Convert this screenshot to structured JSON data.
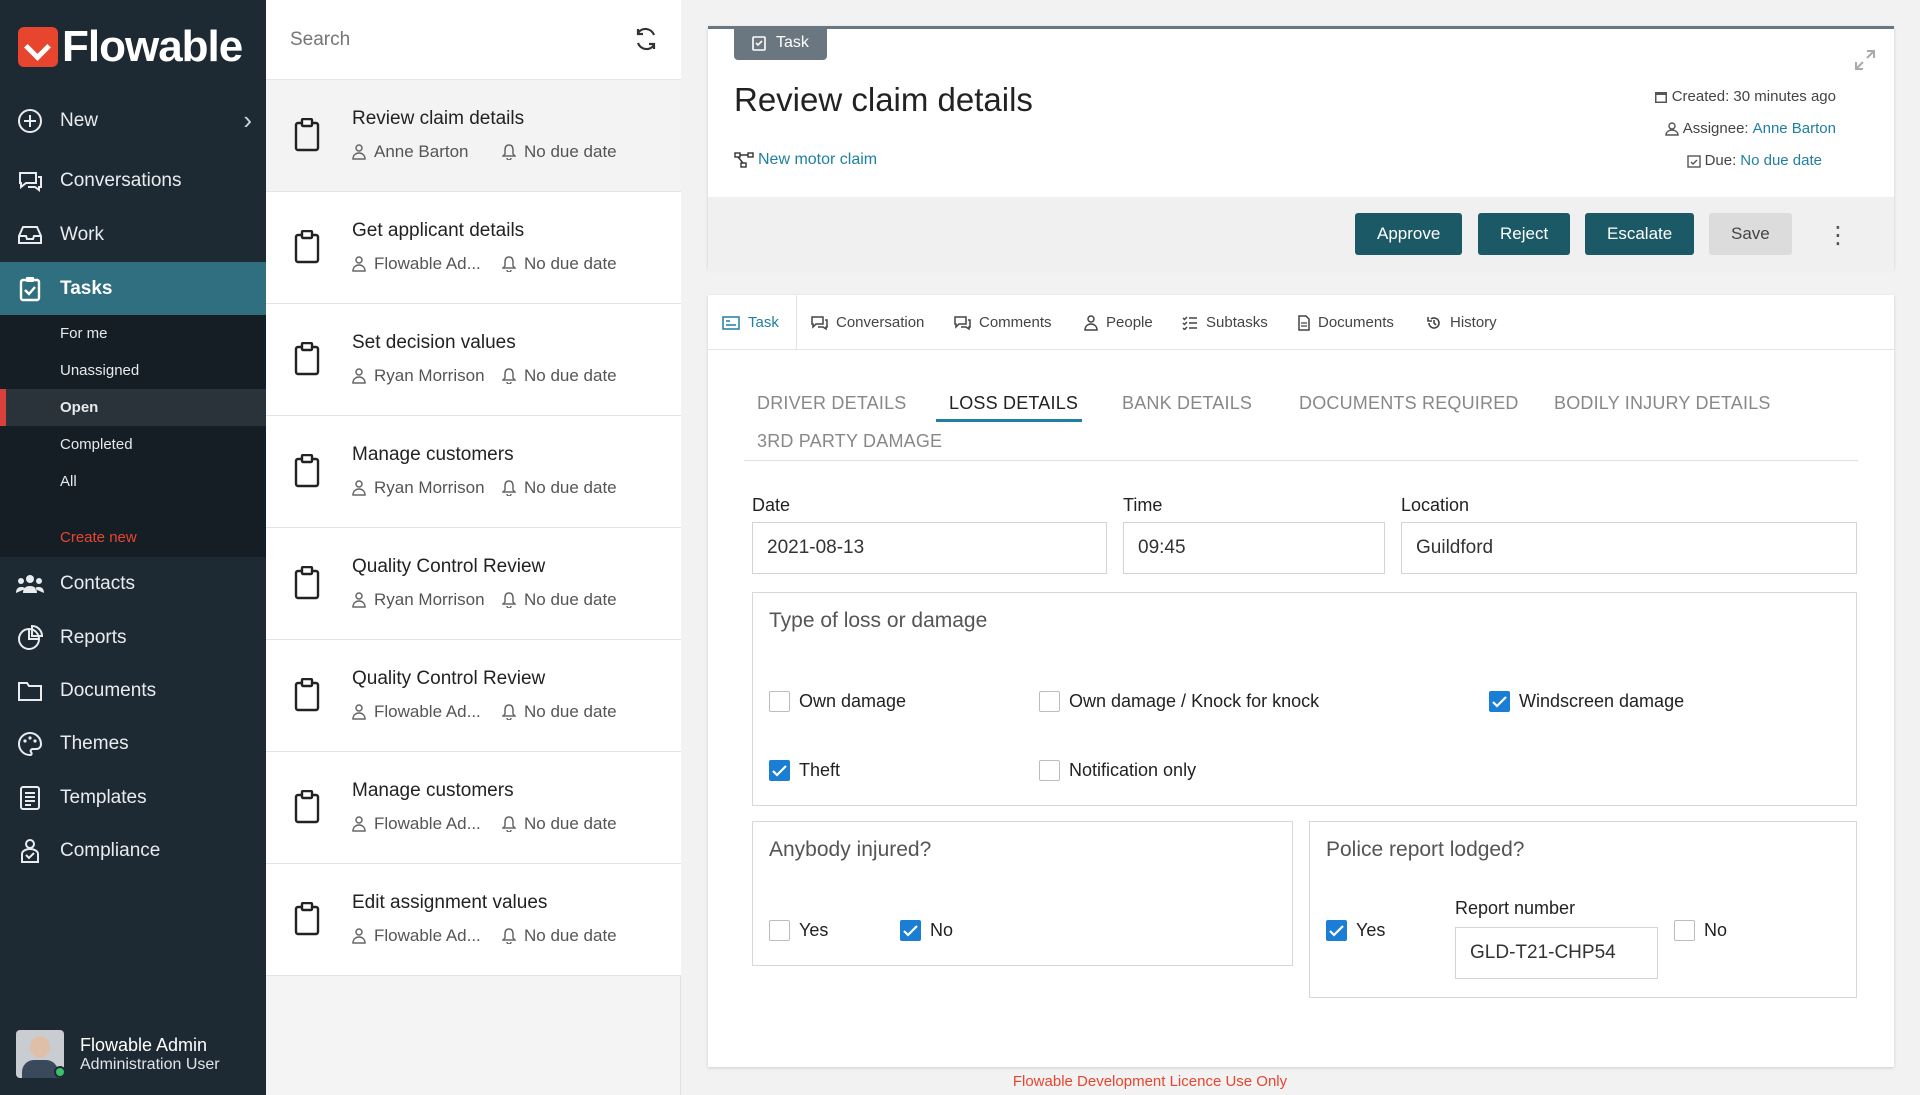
{
  "brand": {
    "name": "Flowable",
    "accent": "#e8452f"
  },
  "sidebar": {
    "items": [
      {
        "label": "New",
        "icon": "plus-circle-icon"
      },
      {
        "label": "Conversations",
        "icon": "chat-icon"
      },
      {
        "label": "Work",
        "icon": "inbox-icon"
      },
      {
        "label": "Tasks",
        "icon": "clipboard-check-icon"
      },
      {
        "label": "Contacts",
        "icon": "users-icon"
      },
      {
        "label": "Reports",
        "icon": "pie-chart-icon"
      },
      {
        "label": "Documents",
        "icon": "folder-icon"
      },
      {
        "label": "Themes",
        "icon": "palette-icon"
      },
      {
        "label": "Templates",
        "icon": "file-text-icon"
      },
      {
        "label": "Compliance",
        "icon": "compliance-icon"
      }
    ],
    "sub_items": [
      "For me",
      "Unassigned",
      "Open",
      "Completed",
      "All",
      "Create new"
    ],
    "active_item": "Tasks",
    "active_sub": "Open",
    "user": {
      "name": "Flowable Admin",
      "role": "Administration User"
    }
  },
  "tasklist": {
    "search_placeholder": "Search",
    "tasks": [
      {
        "title": "Review claim details",
        "assignee": "Anne Barton",
        "due": "No due date"
      },
      {
        "title": "Get applicant details",
        "assignee": "Flowable Ad...",
        "due": "No due date"
      },
      {
        "title": "Set decision values",
        "assignee": "Ryan Morrison",
        "due": "No due date"
      },
      {
        "title": "Manage customers",
        "assignee": "Ryan Morrison",
        "due": "No due date"
      },
      {
        "title": "Quality Control Review",
        "assignee": "Ryan Morrison",
        "due": "No due date"
      },
      {
        "title": "Quality Control Review",
        "assignee": "Flowable Ad...",
        "due": "No due date"
      },
      {
        "title": "Manage customers",
        "assignee": "Flowable Ad...",
        "due": "No due date"
      },
      {
        "title": "Edit assignment values",
        "assignee": "Flowable Ad...",
        "due": "No due date"
      }
    ]
  },
  "header": {
    "chip": "Task",
    "title": "Review claim details",
    "case_link": "New motor claim",
    "created": "Created: 30 minutes ago",
    "assignee_label": "Assignee:",
    "assignee": "Anne Barton",
    "due_label": "Due:",
    "due": "No due date",
    "buttons": {
      "approve": "Approve",
      "reject": "Reject",
      "escalate": "Escalate",
      "save": "Save"
    }
  },
  "tabs": [
    "Task",
    "Conversation",
    "Comments",
    "People",
    "Subtasks",
    "Documents",
    "History"
  ],
  "subtabs": [
    "DRIVER DETAILS",
    "LOSS DETAILS",
    "BANK DETAILS",
    "DOCUMENTS REQUIRED",
    "BODILY INJURY DETAILS",
    "3RD PARTY DAMAGE"
  ],
  "form": {
    "date_label": "Date",
    "date": "2021-08-13",
    "time_label": "Time",
    "time": "09:45",
    "location_label": "Location",
    "location": "Guildford",
    "loss_title": "Type of loss or damage",
    "loss_options": [
      {
        "label": "Own damage",
        "checked": false
      },
      {
        "label": "Own damage / Knock for knock",
        "checked": false
      },
      {
        "label": "Windscreen damage",
        "checked": true
      },
      {
        "label": "Theft",
        "checked": true
      },
      {
        "label": "Notification only",
        "checked": false
      }
    ],
    "injured_title": "Anybody injured?",
    "injured_yes": "Yes",
    "injured_no": "No",
    "police_title": "Police report lodged?",
    "police_yes": "Yes",
    "police_no": "No",
    "report_label": "Report number",
    "report_number": "GLD-T21-CHP54"
  },
  "footer_note": "Flowable Development Licence Use Only",
  "colors": {
    "sidebar": "#1e2a33",
    "active": "#2f6f80",
    "button": "#1c5966",
    "link": "#1f7fa3",
    "check": "#1a7fd4"
  }
}
